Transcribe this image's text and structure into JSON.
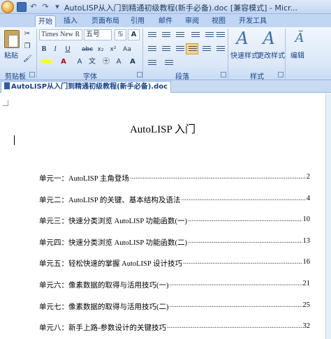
{
  "window": {
    "title": "AutoLISP从入门到精通初级教程(新手必备).doc [兼容模式] - Micr..."
  },
  "tabs": [
    "开始",
    "插入",
    "页面布局",
    "引用",
    "邮件",
    "审阅",
    "视图",
    "开发工具"
  ],
  "ribbon": {
    "clipboard": {
      "paste_label": "粘贴",
      "group_label": "剪贴板"
    },
    "font": {
      "font_name": "Times New R",
      "font_size": "五号",
      "group_label": "字体"
    },
    "paragraph": {
      "group_label": "段落"
    },
    "styles": {
      "quick_styles_label": "快速样式",
      "change_styles_label": "更改样式",
      "group_label": "样式"
    },
    "editing": {
      "label": "编辑"
    }
  },
  "document_tab": {
    "label": "AutoLISP从入门到精通初级教程(新手必备).doc"
  },
  "document": {
    "title": "AutoLISP 入门",
    "toc": [
      {
        "text": "单元一：AutoLISP 主角登场",
        "page": "2"
      },
      {
        "text": "单元二：AutoLISP 的关键、基本结构及语法",
        "page": "4"
      },
      {
        "text": "单元三：快速分类浏览 AutoLISP 功能函数(一)",
        "page": "10"
      },
      {
        "text": "单元四：快速分类浏览 AutoLISP 功能函数(二)",
        "page": "13"
      },
      {
        "text": "单元五：轻松快速的掌握 AutoLISP 设计技巧",
        "page": "16"
      },
      {
        "text": "单元六：像素数据的取得与活用技巧(一)",
        "page": "21"
      },
      {
        "text": "单元七：像素数据的取得与活用技巧(二)",
        "page": "25"
      },
      {
        "text": "单元八：新手上路-参数设计的关键技巧",
        "page": "32"
      }
    ]
  }
}
